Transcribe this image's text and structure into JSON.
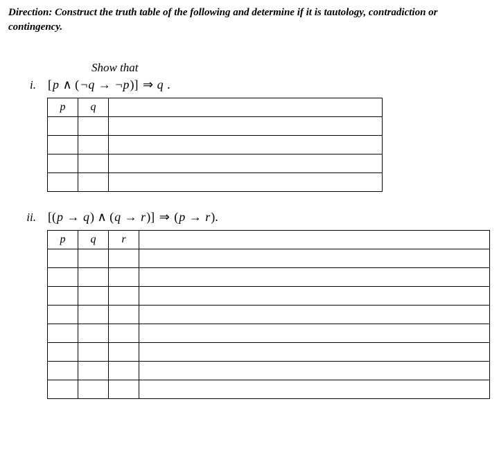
{
  "direction": "Direction: Construct the truth table of the following and determine if it is tautology, contradiction or contingency.",
  "show_that": "Show that",
  "problems": {
    "i": {
      "number": "i.",
      "formula_html": "[<i>p</i> ∧ (¬<i>q</i> → ¬<i>p</i>)] ⇒ <i>q</i> .",
      "headers": [
        "p",
        "q",
        ""
      ],
      "rows": 4
    },
    "ii": {
      "number": "ii.",
      "formula_html": "[(<i>p</i> → <i>q</i>) ∧ (<i>q</i> → <i>r</i>)] ⇒ (<i>p</i> → <i>r</i>).",
      "headers": [
        "p",
        "q",
        "r",
        ""
      ],
      "rows": 8
    }
  }
}
